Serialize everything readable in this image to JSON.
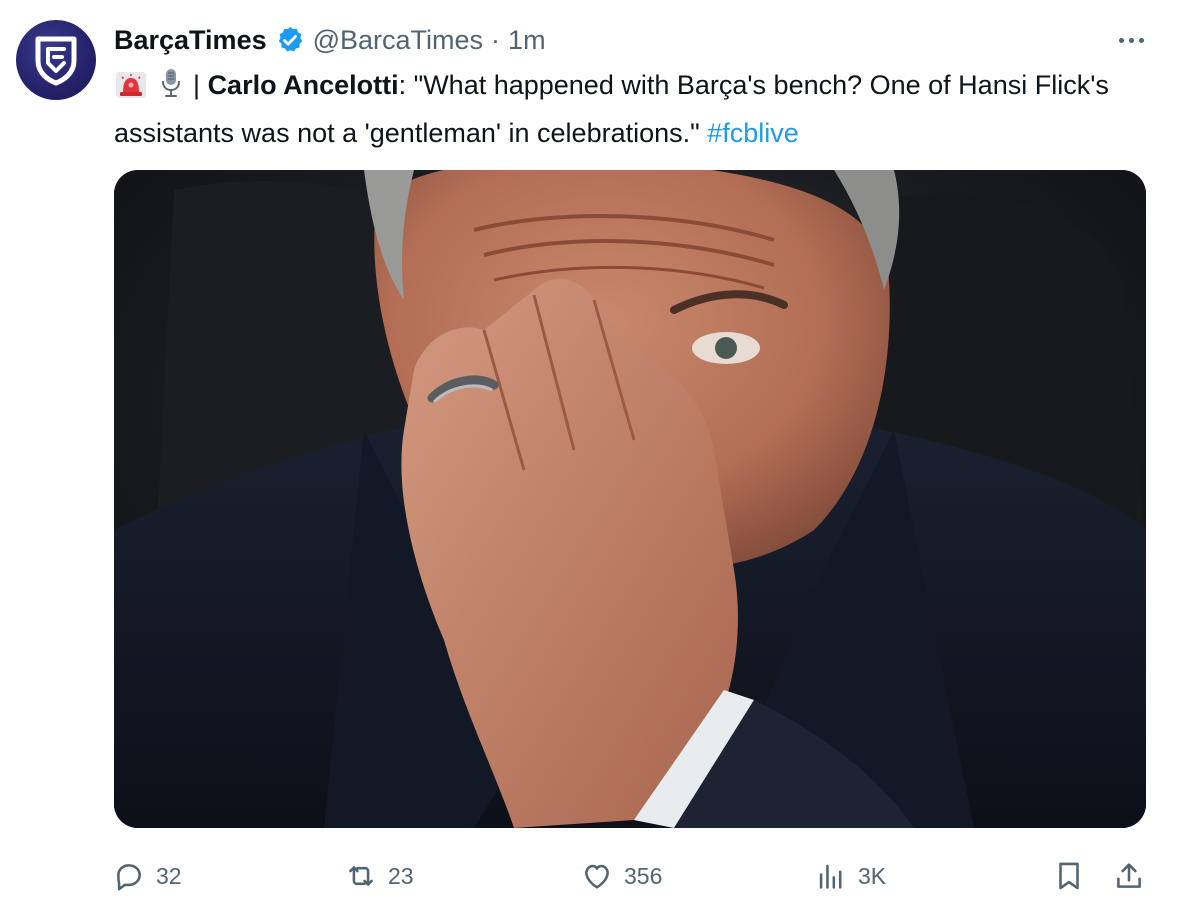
{
  "tweet": {
    "display_name": "BarçaTimes",
    "handle": "@BarcaTimes",
    "separator": "·",
    "time": "1m",
    "text": {
      "divider": "|",
      "speaker": "Carlo Ancelotti",
      "colon": ":",
      "quote": " \"What happened with Barça's bench? One of Hansi Flick's assistants was not a 'gentleman' in celebrations.\" ",
      "hashtag": "#fcblive"
    },
    "icons": {
      "avatar": "shield-logo-icon",
      "verified": "verified-badge-icon",
      "more": "more-horizontal-icon",
      "siren": "siren-emoji-icon",
      "microphone": "microphone-emoji-icon"
    },
    "media": {
      "alt_subject": "photo"
    }
  },
  "actions": {
    "reply": {
      "icon": "reply-icon",
      "count": "32"
    },
    "repost": {
      "icon": "repost-icon",
      "count": "23"
    },
    "like": {
      "icon": "like-icon",
      "count": "356"
    },
    "views": {
      "icon": "views-icon",
      "count": "3K"
    },
    "bookmark": {
      "icon": "bookmark-icon"
    },
    "share": {
      "icon": "share-icon"
    }
  },
  "colors": {
    "text": "#0f1419",
    "secondary": "#536471",
    "link": "#1d9bf0",
    "verified": "#1d9bf0",
    "avatar_bg": "#24226a"
  }
}
